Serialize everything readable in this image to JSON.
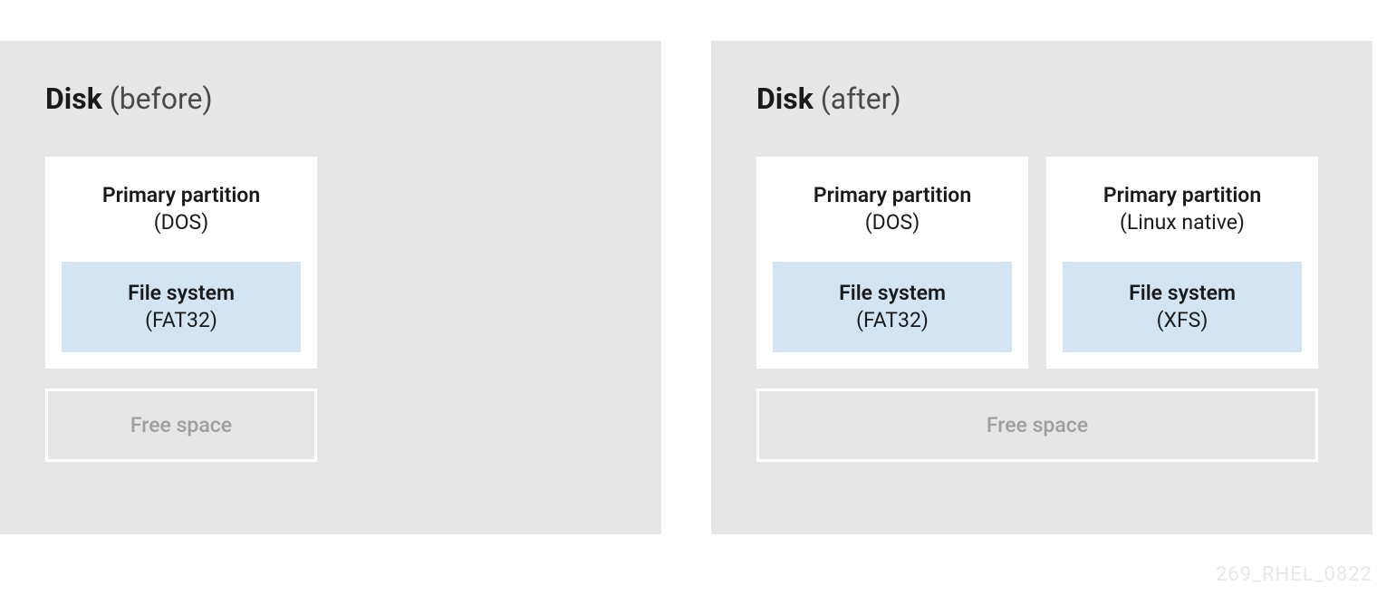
{
  "before": {
    "title_bold": "Disk",
    "title_light": " (before)",
    "partitions": [
      {
        "title": "Primary partition",
        "subtitle": "(DOS)",
        "fs_title": "File system",
        "fs_subtitle": "(FAT32)"
      }
    ],
    "free_space": "Free space"
  },
  "after": {
    "title_bold": "Disk",
    "title_light": " (after)",
    "partitions": [
      {
        "title": "Primary partition",
        "subtitle": "(DOS)",
        "fs_title": "File system",
        "fs_subtitle": "(FAT32)"
      },
      {
        "title": "Primary partition",
        "subtitle": "(Linux native)",
        "fs_title": "File system",
        "fs_subtitle": "(XFS)"
      }
    ],
    "free_space": "Free space"
  },
  "watermark": "269_RHEL_0822"
}
